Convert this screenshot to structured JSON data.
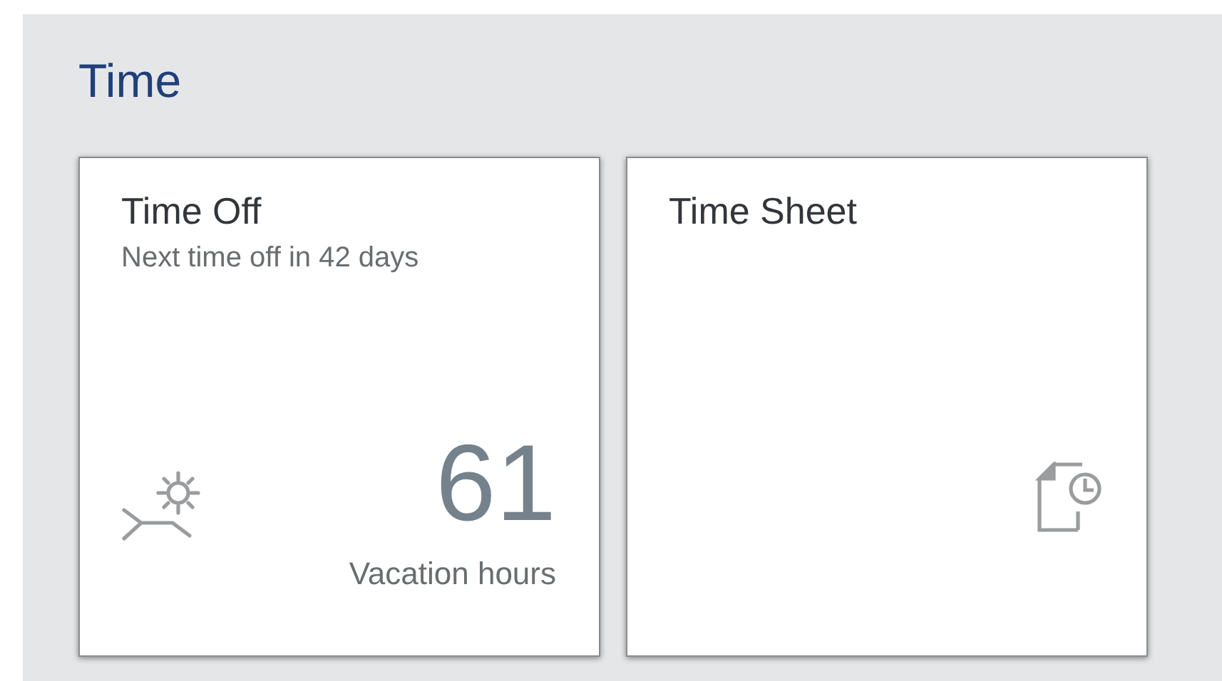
{
  "section": {
    "title": "Time"
  },
  "tiles": [
    {
      "kind": "kpi",
      "title": "Time Off",
      "subtitle": "Next time off in 42 days",
      "value": "61",
      "unit": "Vacation hours"
    },
    {
      "kind": "icon",
      "title": "Time Sheet"
    }
  ]
}
